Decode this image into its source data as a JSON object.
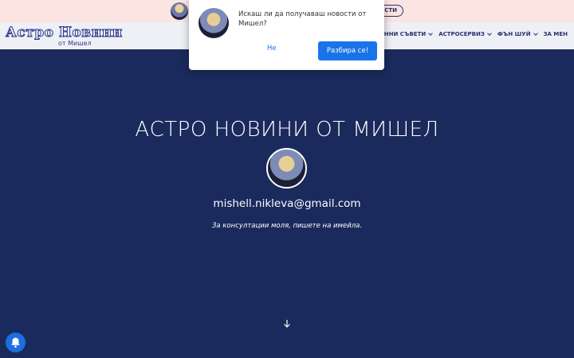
{
  "topbar": {
    "pill_label": "ОСТИ"
  },
  "logo": {
    "title": "Астро Новини",
    "subtitle": "от Мишел"
  },
  "nav": {
    "items": [
      {
        "label": "И",
        "has_dropdown": false
      },
      {
        "label": "ЛУННИ СЪВЕТИ",
        "has_dropdown": true
      },
      {
        "label": "АСТРОСЕРВИЗ",
        "has_dropdown": true
      },
      {
        "label": "ФЪН ШУЙ",
        "has_dropdown": true
      },
      {
        "label": "ЗА МЕН",
        "has_dropdown": false
      }
    ]
  },
  "hero": {
    "title": "АСТРО НОВИНИ ОТ МИШЕЛ",
    "email": "mishell.nikleva@gmail.com",
    "note": "За консултации моля, пишете на имейла."
  },
  "popup": {
    "message": "Искаш ли да получаваш новости от Мишел?",
    "no_label": "Не",
    "yes_label": "Разбира се!"
  },
  "colors": {
    "background": "#1a2a5c",
    "accent": "#1a73e8",
    "navbar": "#eef0f6",
    "topbar": "#fbe4e1"
  }
}
